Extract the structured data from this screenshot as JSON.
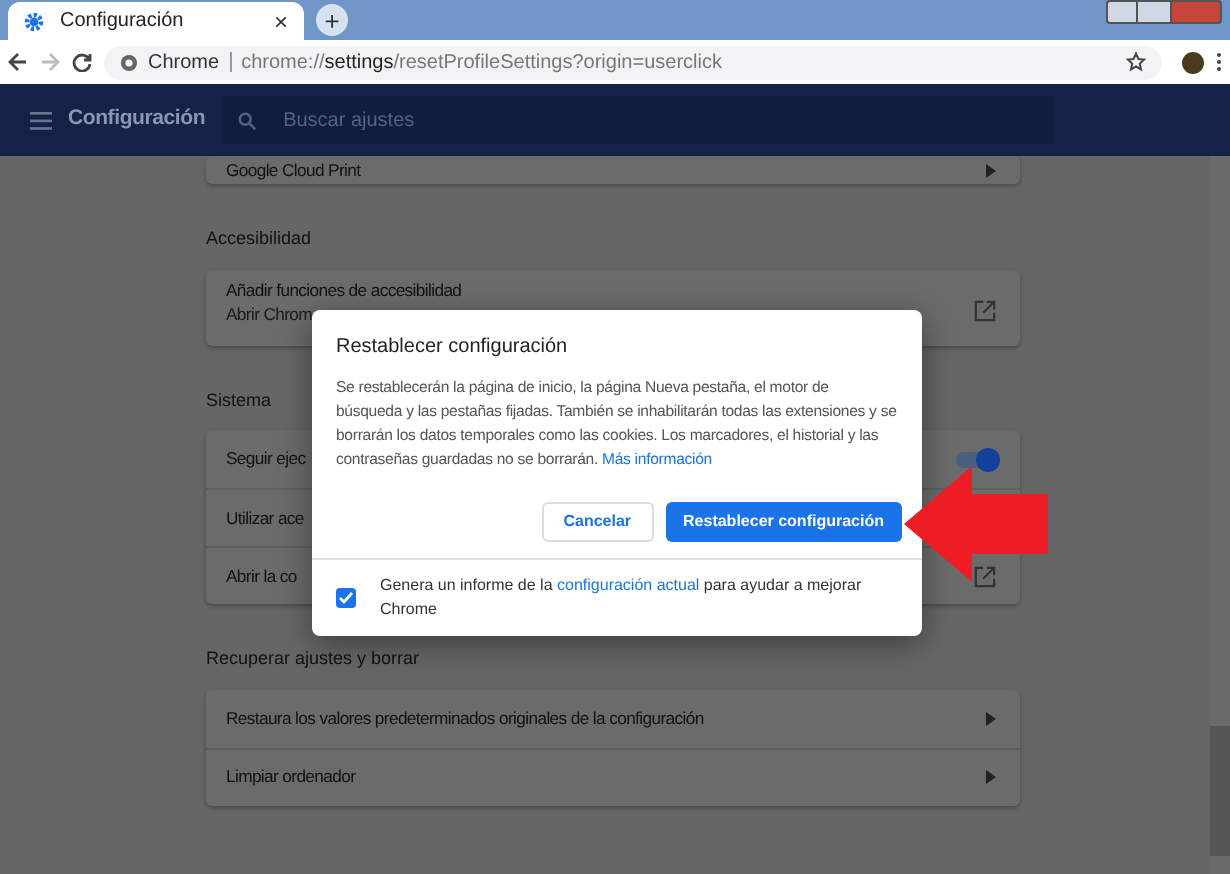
{
  "browser": {
    "tab": {
      "title": "Configuración",
      "close": "×"
    },
    "new_tab": "+",
    "address": {
      "site": "Chrome",
      "url_prefix": "chrome://",
      "url_bold": "settings",
      "url_rest": "/resetProfileSettings?origin=userclick"
    }
  },
  "header": {
    "title": "Configuración",
    "search": {
      "placeholder": "Buscar ajustes"
    }
  },
  "sections": [
    {
      "rows": [
        {
          "kind": "arrow",
          "label": "Google Cloud Print"
        }
      ]
    },
    {
      "title": "Accesibilidad",
      "rows": [
        {
          "kind": "external",
          "label": "Añadir funciones de accesibilidad",
          "sublabel": "Abrir Chrom"
        }
      ]
    },
    {
      "title": "Sistema",
      "rows": [
        {
          "kind": "toggle",
          "label": "Seguir ejec",
          "on": true
        },
        {
          "kind": "plain",
          "label": "Utilizar ace"
        },
        {
          "kind": "external",
          "label": "Abrir la co"
        }
      ]
    },
    {
      "title": "Recuperar ajustes y borrar",
      "rows": [
        {
          "kind": "arrow",
          "label": "Restaura los valores predeterminados originales de la configuración"
        },
        {
          "kind": "arrow",
          "label": "Limpiar ordenador"
        }
      ]
    }
  ],
  "dialog": {
    "title": "Restablecer configuración",
    "body": "Se restablecerán la página de inicio, la página Nueva pestaña, el motor de búsqueda y las pestañas fijadas. También se inhabilitarán todas las extensiones y se borrarán los datos temporales como las cookies. Los marcadores, el historial y las contraseñas guardadas no se borrarán.",
    "link": "Más información",
    "cancel": "Cancelar",
    "confirm": "Restablecer configuración",
    "report": {
      "checked": true,
      "before": "Genera un informe de la",
      "link": "configuración actual",
      "after": "para ayudar a mejorar Chrome"
    }
  }
}
